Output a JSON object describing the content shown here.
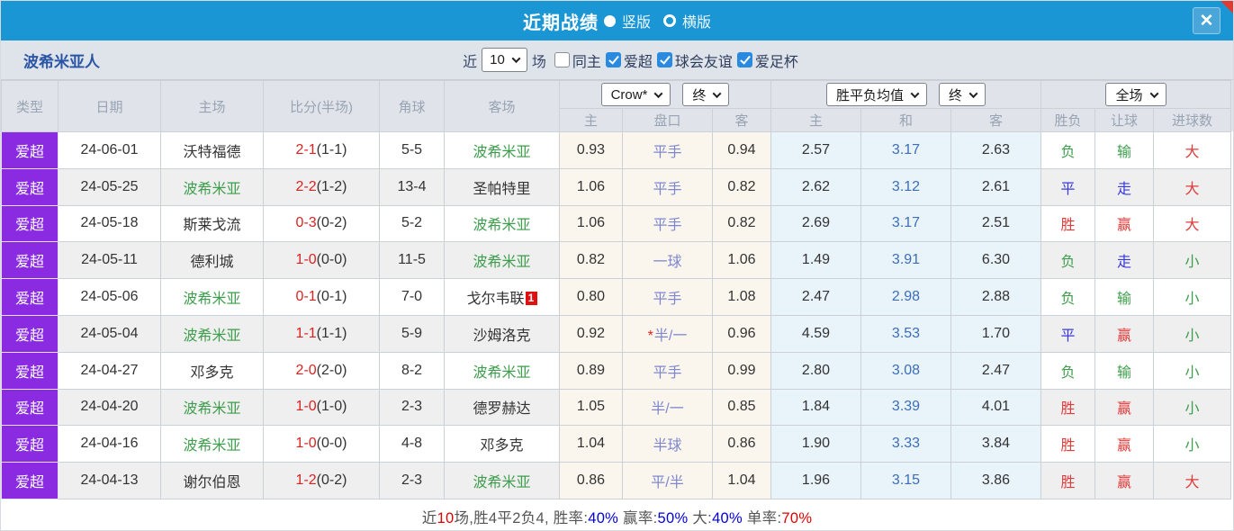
{
  "header": {
    "title": "近期战绩",
    "vertical_label": "竖版",
    "horizontal_label": "横版",
    "vertical_selected": true
  },
  "filter": {
    "team": "波希米亚人",
    "near_label": "近",
    "match_count": "10",
    "matches_label": "场",
    "checkboxes": [
      {
        "label": "同主",
        "checked": false
      },
      {
        "label": "爱超",
        "checked": true
      },
      {
        "label": "球会友谊",
        "checked": true
      },
      {
        "label": "爱足杯",
        "checked": true
      }
    ]
  },
  "table": {
    "static_headers": [
      "类型",
      "日期",
      "主场",
      "比分(半场)",
      "角球",
      "客场"
    ],
    "dropdowns": {
      "handicap_source": "Crow*",
      "handicap_time": "终",
      "odds_source": "胜平负均值",
      "odds_time": "终",
      "result_scope": "全场"
    },
    "sub_headers": {
      "handicap": [
        "主",
        "盘口",
        "客"
      ],
      "europe": [
        "主",
        "和",
        "客"
      ],
      "result": [
        "胜负",
        "让球",
        "进球数"
      ]
    },
    "rows": [
      {
        "type": "爱超",
        "date": "24-06-01",
        "home": "沃特福德",
        "home_is_team": false,
        "score_ft": "2-1",
        "score_ht": "(1-1)",
        "corners": "5-5",
        "away": "波希米亚",
        "away_is_team": true,
        "away_badge": "",
        "ah_home": "0.93",
        "ah_line": "平手",
        "ah_star": false,
        "ah_away": "0.94",
        "odds_home": "2.57",
        "odds_draw": "3.17",
        "odds_away": "2.63",
        "results": [
          "负",
          "输",
          "大"
        ]
      },
      {
        "type": "爱超",
        "date": "24-05-25",
        "home": "波希米亚",
        "home_is_team": true,
        "score_ft": "2-2",
        "score_ht": "(1-2)",
        "corners": "13-4",
        "away": "圣帕特里",
        "away_is_team": false,
        "away_badge": "",
        "ah_home": "1.06",
        "ah_line": "平手",
        "ah_star": false,
        "ah_away": "0.82",
        "odds_home": "2.62",
        "odds_draw": "3.12",
        "odds_away": "2.61",
        "results": [
          "平",
          "走",
          "大"
        ]
      },
      {
        "type": "爱超",
        "date": "24-05-18",
        "home": "斯莱戈流",
        "home_is_team": false,
        "score_ft": "0-3",
        "score_ht": "(0-2)",
        "corners": "5-2",
        "away": "波希米亚",
        "away_is_team": true,
        "away_badge": "",
        "ah_home": "1.06",
        "ah_line": "平手",
        "ah_star": false,
        "ah_away": "0.82",
        "odds_home": "2.69",
        "odds_draw": "3.17",
        "odds_away": "2.51",
        "results": [
          "胜",
          "赢",
          "大"
        ]
      },
      {
        "type": "爱超",
        "date": "24-05-11",
        "home": "德利城",
        "home_is_team": false,
        "score_ft": "1-0",
        "score_ht": "(0-0)",
        "corners": "11-5",
        "away": "波希米亚",
        "away_is_team": true,
        "away_badge": "",
        "ah_home": "0.82",
        "ah_line": "一球",
        "ah_star": false,
        "ah_away": "1.06",
        "odds_home": "1.49",
        "odds_draw": "3.91",
        "odds_away": "6.30",
        "results": [
          "负",
          "走",
          "小"
        ]
      },
      {
        "type": "爱超",
        "date": "24-05-06",
        "home": "波希米亚",
        "home_is_team": true,
        "score_ft": "0-1",
        "score_ht": "(0-1)",
        "corners": "7-0",
        "away": "戈尔韦联",
        "away_is_team": false,
        "away_badge": "1",
        "ah_home": "0.80",
        "ah_line": "平手",
        "ah_star": false,
        "ah_away": "1.08",
        "odds_home": "2.47",
        "odds_draw": "2.98",
        "odds_away": "2.88",
        "results": [
          "负",
          "输",
          "小"
        ]
      },
      {
        "type": "爱超",
        "date": "24-05-04",
        "home": "波希米亚",
        "home_is_team": true,
        "score_ft": "1-1",
        "score_ht": "(1-1)",
        "corners": "5-9",
        "away": "沙姆洛克",
        "away_is_team": false,
        "away_badge": "",
        "ah_home": "0.92",
        "ah_line": "半/一",
        "ah_star": true,
        "ah_away": "0.96",
        "odds_home": "4.59",
        "odds_draw": "3.53",
        "odds_away": "1.70",
        "results": [
          "平",
          "赢",
          "小"
        ]
      },
      {
        "type": "爱超",
        "date": "24-04-27",
        "home": "邓多克",
        "home_is_team": false,
        "score_ft": "2-0",
        "score_ht": "(2-0)",
        "corners": "8-2",
        "away": "波希米亚",
        "away_is_team": true,
        "away_badge": "",
        "ah_home": "0.89",
        "ah_line": "平手",
        "ah_star": false,
        "ah_away": "0.99",
        "odds_home": "2.80",
        "odds_draw": "3.08",
        "odds_away": "2.47",
        "results": [
          "负",
          "输",
          "小"
        ]
      },
      {
        "type": "爱超",
        "date": "24-04-20",
        "home": "波希米亚",
        "home_is_team": true,
        "score_ft": "1-0",
        "score_ht": "(1-0)",
        "corners": "2-3",
        "away": "德罗赫达",
        "away_is_team": false,
        "away_badge": "",
        "ah_home": "1.05",
        "ah_line": "半/一",
        "ah_star": false,
        "ah_away": "0.85",
        "odds_home": "1.84",
        "odds_draw": "3.39",
        "odds_away": "4.01",
        "results": [
          "胜",
          "赢",
          "小"
        ]
      },
      {
        "type": "爱超",
        "date": "24-04-16",
        "home": "波希米亚",
        "home_is_team": true,
        "score_ft": "1-0",
        "score_ht": "(0-0)",
        "corners": "4-8",
        "away": "邓多克",
        "away_is_team": false,
        "away_badge": "",
        "ah_home": "1.04",
        "ah_line": "半球",
        "ah_star": false,
        "ah_away": "0.86",
        "odds_home": "1.90",
        "odds_draw": "3.33",
        "odds_away": "3.84",
        "results": [
          "胜",
          "赢",
          "小"
        ]
      },
      {
        "type": "爱超",
        "date": "24-04-13",
        "home": "谢尔伯恩",
        "home_is_team": false,
        "score_ft": "1-2",
        "score_ht": "(0-2)",
        "corners": "2-3",
        "away": "波希米亚",
        "away_is_team": true,
        "away_badge": "",
        "ah_home": "0.86",
        "ah_line": "平/半",
        "ah_star": false,
        "ah_away": "1.04",
        "odds_home": "1.96",
        "odds_draw": "3.15",
        "odds_away": "3.86",
        "results": [
          "胜",
          "赢",
          "大"
        ]
      }
    ]
  },
  "footer": {
    "segments": [
      {
        "text": "近",
        "color": "#555555"
      },
      {
        "text": "10",
        "color": "#dd0000"
      },
      {
        "text": "场,胜4平2负4, 胜率:",
        "color": "#555555"
      },
      {
        "text": "40%",
        "color": "#0000dd"
      },
      {
        "text": " 赢率:",
        "color": "#555555"
      },
      {
        "text": "50%",
        "color": "#0000dd"
      },
      {
        "text": " 大:",
        "color": "#555555"
      },
      {
        "text": "40%",
        "color": "#0000dd"
      },
      {
        "text": " 单率:",
        "color": "#555555"
      },
      {
        "text": "70%",
        "color": "#dd0000"
      }
    ]
  },
  "colors": {
    "topbar_blue": "#1b96d4",
    "accent_purple": "#8a2be2",
    "team_highlight": "#3f9e4d",
    "score_red": "#dd2222",
    "handicap_line_blue": "#7d87cf",
    "draw_odds_blue": "#3d6eb8",
    "checkbox_blue": "#2a8ae0",
    "result_map": {
      "胜": "#e23b3b",
      "赢": "#e23b3b",
      "大": "#e23b3b",
      "平": "#3939dd",
      "走": "#3939dd",
      "负": "#3f9e4d",
      "输": "#3f9e4d",
      "小": "#3f9e4d"
    }
  }
}
